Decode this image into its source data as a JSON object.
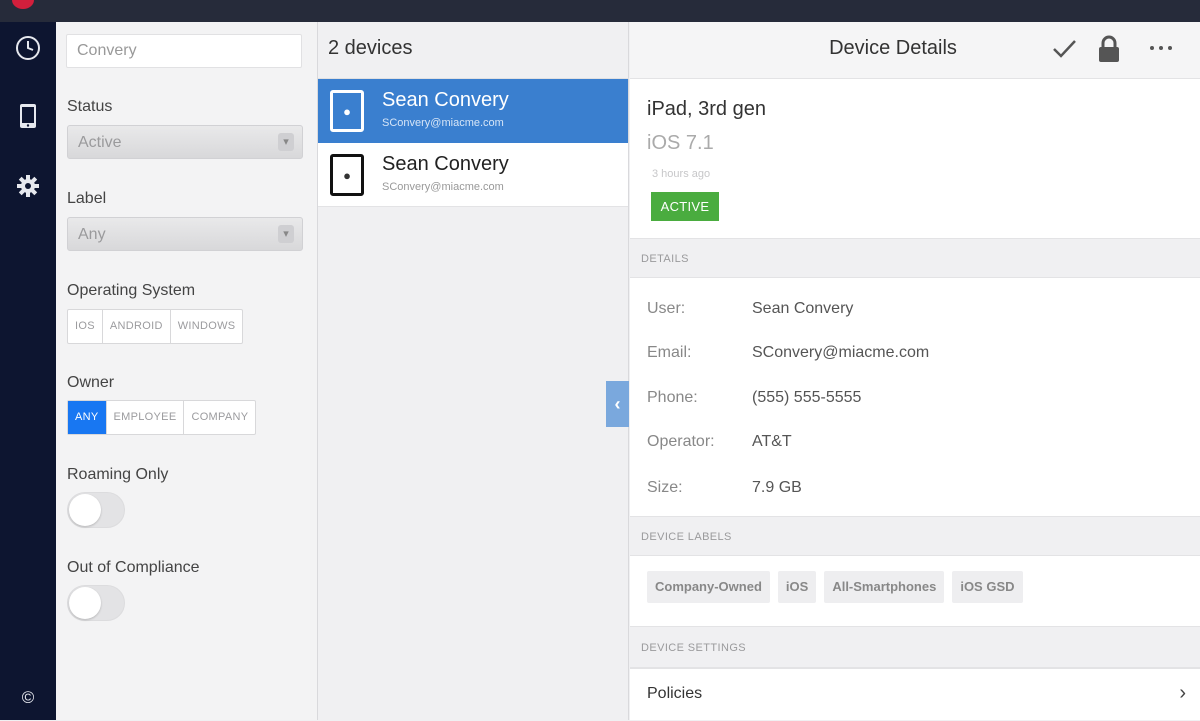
{
  "rail": {
    "items": [
      {
        "icon": "clock-icon"
      },
      {
        "icon": "mobile-device-icon"
      },
      {
        "icon": "gear-icon"
      }
    ],
    "footer_symbol": "©"
  },
  "filters": {
    "search": {
      "value": "Convery",
      "placeholder": ""
    },
    "status": {
      "label": "Status",
      "value": "Active"
    },
    "label": {
      "label": "Label",
      "value": "Any"
    },
    "os": {
      "label": "Operating System",
      "options": [
        "IOS",
        "ANDROID",
        "WINDOWS"
      ]
    },
    "owner": {
      "label": "Owner",
      "options": [
        "ANY",
        "EMPLOYEE",
        "COMPANY"
      ],
      "selected": "ANY"
    },
    "roaming": {
      "label": "Roaming Only",
      "on": false
    },
    "compliance": {
      "label": "Out of Compliance",
      "on": false
    }
  },
  "list": {
    "header": "2 devices",
    "devices": [
      {
        "name": "Sean Convery",
        "email": "SConvery@miacme.com",
        "selected": true
      },
      {
        "name": "Sean Convery",
        "email": "SConvery@miacme.com",
        "selected": false
      }
    ]
  },
  "details": {
    "title": "Device Details",
    "actions": [
      "check-icon",
      "lock-icon",
      "more-icon"
    ],
    "model": "iPad, 3rd gen",
    "os": "iOS 7.1",
    "last_seen": "3 hours ago",
    "status_badge": "ACTIVE",
    "section_details": "DETAILS",
    "fields": [
      {
        "key": "User:",
        "value": "Sean Convery"
      },
      {
        "key": "Email:",
        "value": "SConvery@miacme.com"
      },
      {
        "key": "Phone:",
        "value": "(555) 555-5555"
      },
      {
        "key": "Operator:",
        "value": "AT&T"
      },
      {
        "key": "Size:",
        "value": "7.9 GB"
      }
    ],
    "section_labels": "DEVICE LABELS",
    "labels": [
      "Company-Owned",
      "iOS",
      "All-Smartphones",
      "iOS GSD"
    ],
    "section_settings": "DEVICE SETTINGS",
    "policies": "Policies"
  },
  "colors": {
    "rail": "#0d1530",
    "selection": "#3a7fcf",
    "accent": "#1877f2",
    "active_badge": "#4aac3f"
  }
}
